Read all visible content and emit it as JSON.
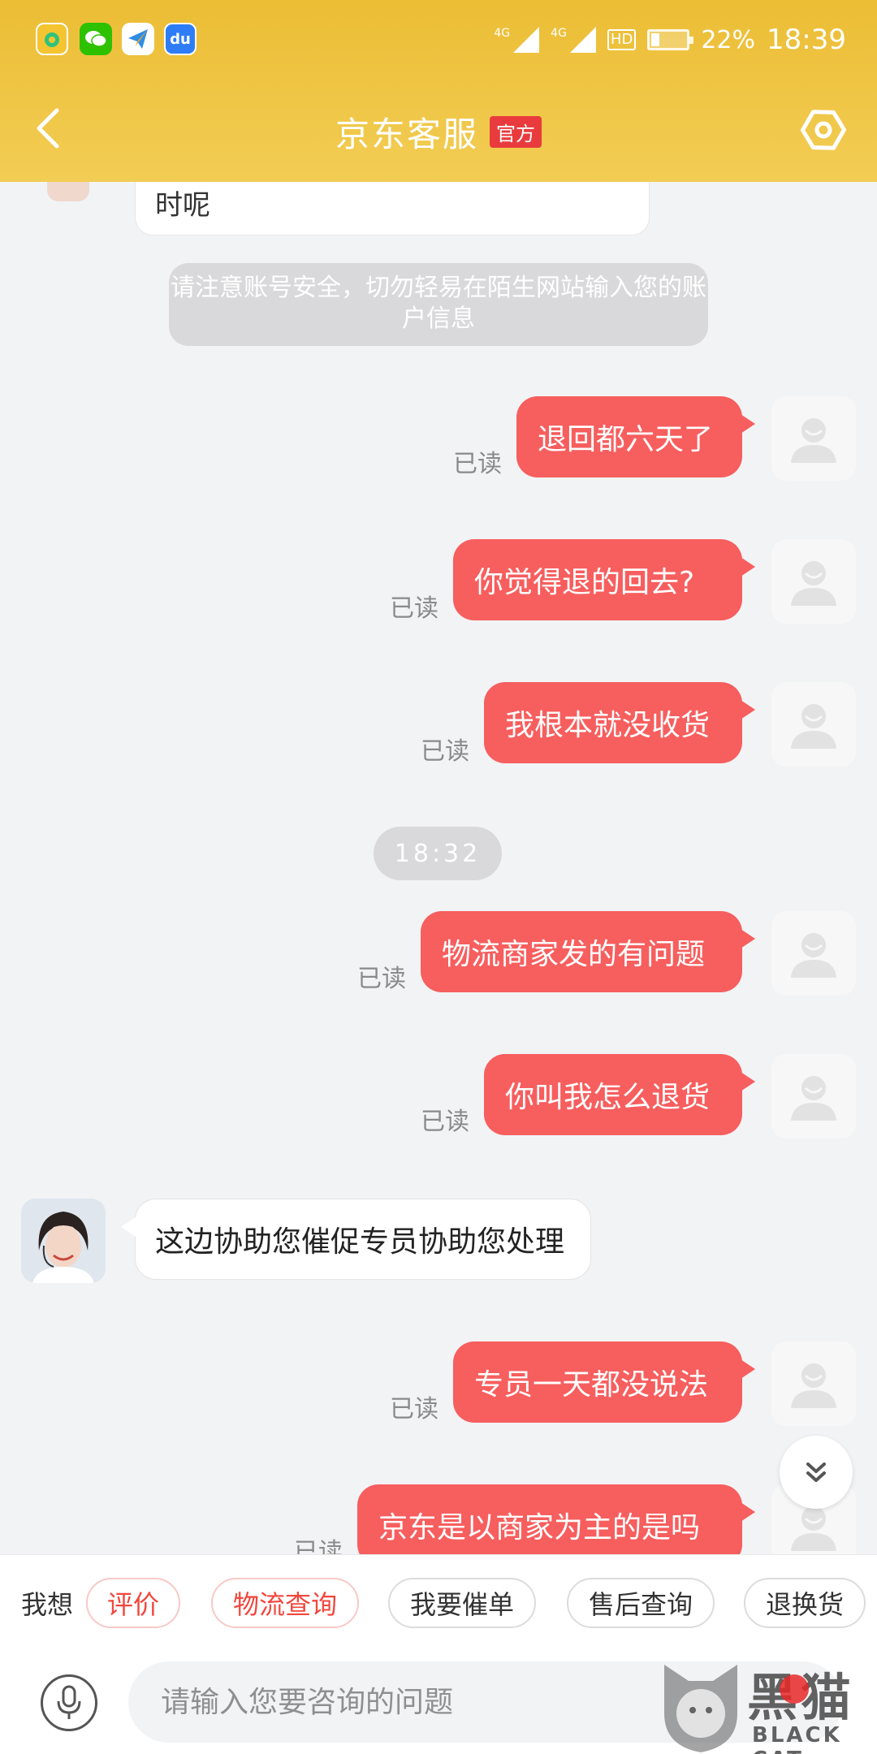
{
  "status_bar": {
    "network_1": "4G",
    "network_2": "4G",
    "hd": "HD",
    "battery_percent": "22%",
    "battery_level": 0.22,
    "time": "18:39",
    "apps": [
      "music-app-icon",
      "wechat-icon",
      "paper-plane-app-icon",
      "du-app-icon"
    ],
    "app_du_text": "du"
  },
  "header": {
    "title": "京东客服",
    "badge": "官方"
  },
  "chat": {
    "partial_message": "时呢",
    "security_notice": "请注意账号安全，切勿轻易在陌生网站输入您的账户信息",
    "time_divider": "18:32",
    "read_label": "已读",
    "messages": [
      {
        "text": "退回都六天了",
        "from": "user"
      },
      {
        "text": "你觉得退的回去?",
        "from": "user"
      },
      {
        "text": "我根本就没收货",
        "from": "user"
      },
      {
        "text": "物流商家发的有问题",
        "from": "user"
      },
      {
        "text": "你叫我怎么退货",
        "from": "user"
      },
      {
        "text": "这边协助您催促专员协助您处理",
        "from": "agent"
      },
      {
        "text": "专员一天都没说法",
        "from": "user"
      },
      {
        "text": "京东是以商家为主的是吗",
        "from": "user"
      }
    ]
  },
  "quick_bar": {
    "label": "我想",
    "chips": [
      "评价",
      "物流查询",
      "我要催单",
      "售后查询",
      "退换货"
    ]
  },
  "input": {
    "placeholder": "请输入您要咨询的问题"
  },
  "watermark": {
    "title": "黑猫",
    "subtitle": "BLACK CAT"
  },
  "colors": {
    "header_yellow": "#f0c640",
    "bubble_red": "#f75e5e",
    "chip_red": "#f2463d",
    "background": "#f2f3f5"
  }
}
